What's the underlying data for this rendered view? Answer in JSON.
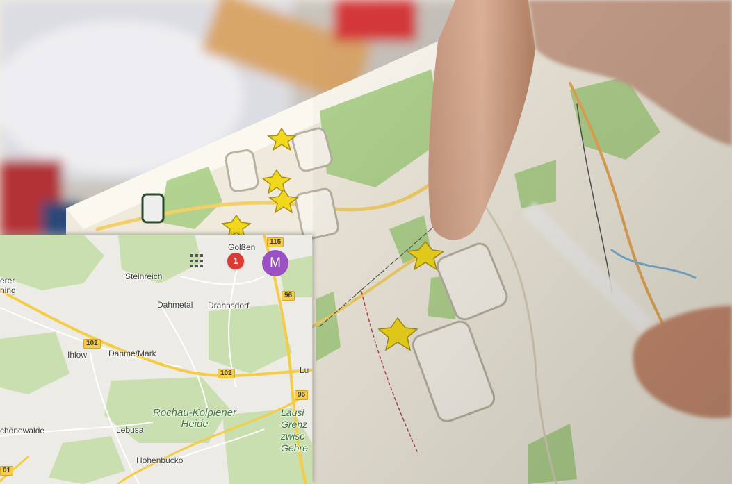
{
  "photo": {
    "description_icon": "paper-map-photo",
    "colors": {
      "paper": "#efeadc",
      "forest": "#a9cf85",
      "road": "#f3d067",
      "marker": "#f2d81c"
    }
  },
  "gmap": {
    "places": [
      {
        "id": "golssen",
        "label": "Golßen"
      },
      {
        "id": "steinreich",
        "label": "Steinreich"
      },
      {
        "id": "dahmetal",
        "label": "Dahmetal"
      },
      {
        "id": "drahnsdorf",
        "label": "Drahnsdorf"
      },
      {
        "id": "ihlow",
        "label": "Ihlow"
      },
      {
        "id": "dahme",
        "label": "Dahme/Mark"
      },
      {
        "id": "lu",
        "label": "Lu"
      },
      {
        "id": "lebusa",
        "label": "Lebusa"
      },
      {
        "id": "schonewalde",
        "label": "chönewalde"
      },
      {
        "id": "hohenbucko",
        "label": "Hohenbucko"
      },
      {
        "id": "erer",
        "label": "erer"
      },
      {
        "id": "ning",
        "label": "ning"
      }
    ],
    "heide_line1": "Rochau-Kolpiener",
    "heide_line2": "Heide",
    "lausitz_lines": [
      "Lausi",
      "Grenz",
      "zwisc",
      "Gehre"
    ],
    "road_shields": [
      {
        "id": "r115",
        "label": "115"
      },
      {
        "id": "r96a",
        "label": "96"
      },
      {
        "id": "r102a",
        "label": "102"
      },
      {
        "id": "r102b",
        "label": "102"
      },
      {
        "id": "r96b",
        "label": "96"
      },
      {
        "id": "r01",
        "label": "01"
      }
    ],
    "notification_count": "1",
    "avatar_letter": "M",
    "icons": {
      "apps": "apps-grid-icon"
    },
    "colors": {
      "land": "#ecebe5",
      "forest": "#c9dfb0",
      "highway": "#f4cc45",
      "avatar": "#9b51c4",
      "badge": "#db3a34"
    }
  }
}
